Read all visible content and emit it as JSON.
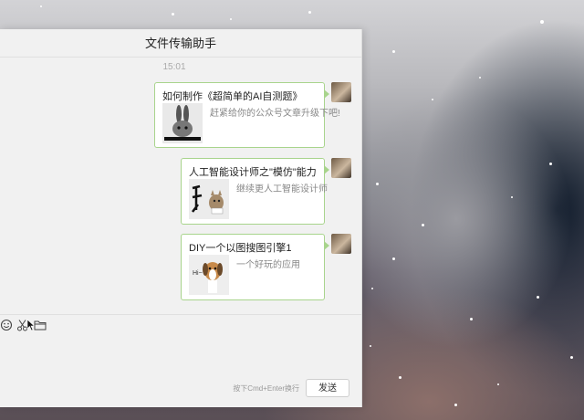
{
  "window": {
    "title": "文件传输助手"
  },
  "chat": {
    "timestamp": "15:01",
    "messages": [
      {
        "title": "如何制作《超简单的AI自测题》",
        "description": "赶紧给你的公众号文章升级下吧!",
        "thumb": "bunny-on-laptop"
      },
      {
        "title": "人工智能设计师之\"模仿\"能力",
        "description": "继续更人工智能设计师",
        "thumb": "calligraphy-cat"
      },
      {
        "title": "DIY一个以图搜图引擎1",
        "description": "一个好玩的应用",
        "thumb": "dog"
      }
    ]
  },
  "input": {
    "hint": "按下Cmd+Enter换行",
    "send_label": "发送"
  },
  "toolbar": {
    "icons": [
      "emoji-icon",
      "scissors-icon",
      "folder-icon"
    ]
  }
}
